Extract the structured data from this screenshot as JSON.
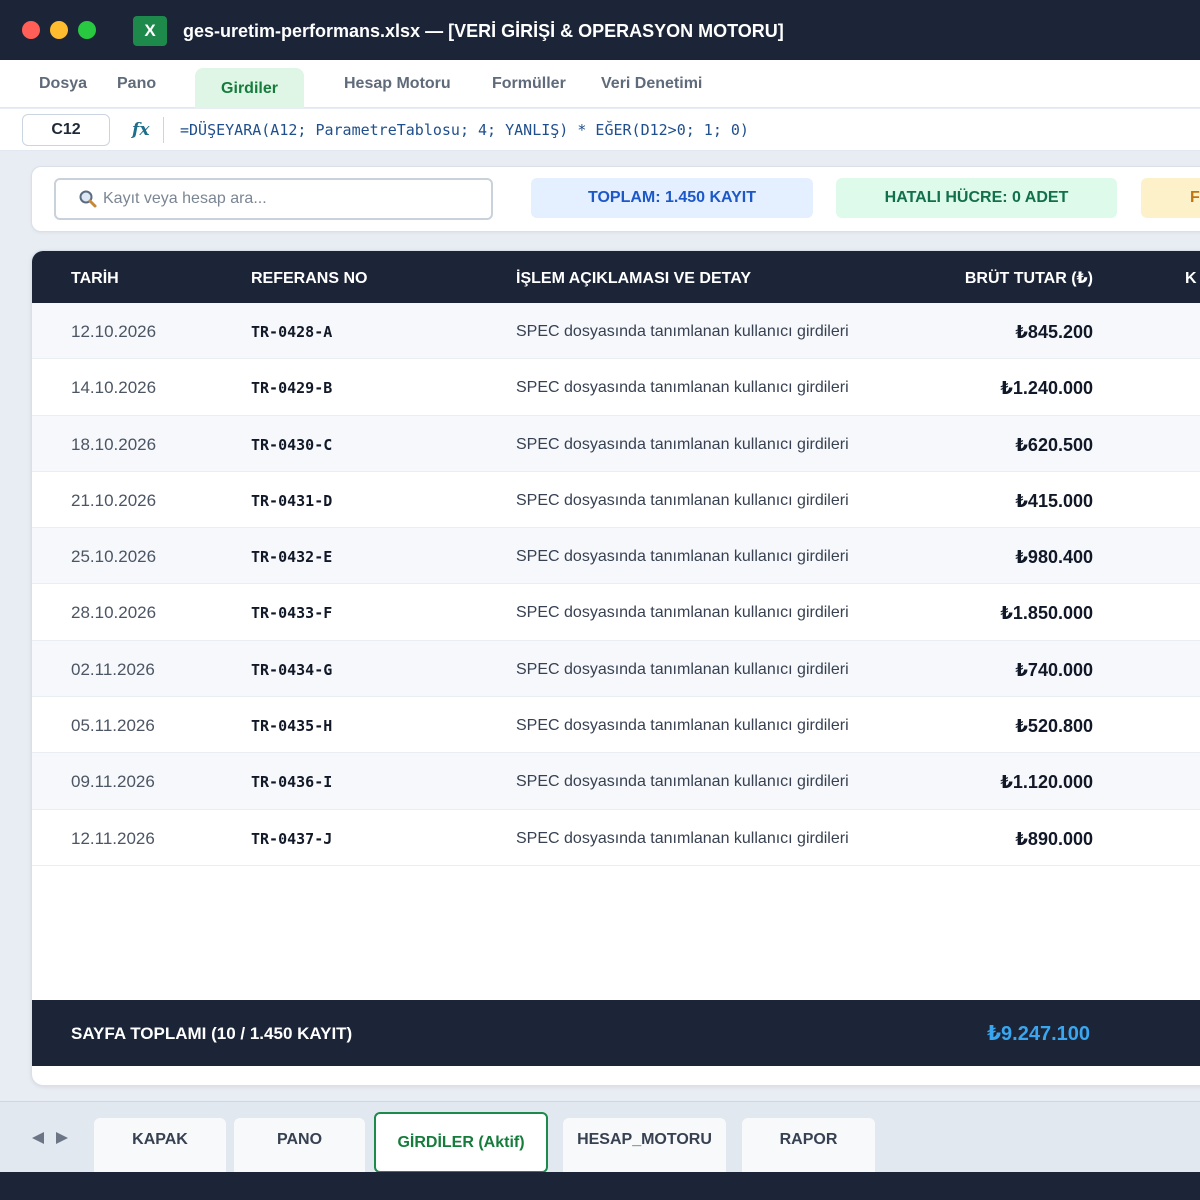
{
  "window": {
    "title": "ges-uretim-performans.xlsx — [VERİ GİRİŞİ & OPERASYON MOTORU]",
    "app_icon_glyph": "X",
    "app_icon_name": "excel-icon",
    "accent_color": "#1d8a4b"
  },
  "menu": {
    "items": [
      "Dosya",
      "Pano",
      "Girdiler",
      "Hesap Motoru",
      "Formüller",
      "Veri Denetimi"
    ],
    "active": "Girdiler"
  },
  "formula_bar": {
    "cell_ref": "C12",
    "fx_label": "fx",
    "formula": "=DÜŞEYARA(A12; ParametreTablosu; 4; YANLIŞ) * EĞER(D12>0; 1; 0)"
  },
  "toolbar": {
    "search_placeholder": "Kayıt veya hesap ara...",
    "badges": {
      "total": "TOPLAM: 1.450 KAYIT",
      "errors": "HATALI HÜCRE: 0 ADET",
      "partial": "F"
    }
  },
  "table": {
    "columns": {
      "date": "TARİH",
      "ref": "REFERANS NO",
      "desc": "İŞLEM AÇIKLAMASI VE DETAY",
      "amount": "BRÜT TUTAR (₺)",
      "extra": "K"
    },
    "rows": [
      {
        "date": "12.10.2026",
        "ref": "TR-0428-A",
        "desc": "SPEC dosyasında tanımlanan kullanıcı girdileri",
        "amount": "₺845.200"
      },
      {
        "date": "14.10.2026",
        "ref": "TR-0429-B",
        "desc": "SPEC dosyasında tanımlanan kullanıcı girdileri",
        "amount": "₺1.240.000"
      },
      {
        "date": "18.10.2026",
        "ref": "TR-0430-C",
        "desc": "SPEC dosyasında tanımlanan kullanıcı girdileri",
        "amount": "₺620.500"
      },
      {
        "date": "21.10.2026",
        "ref": "TR-0431-D",
        "desc": "SPEC dosyasında tanımlanan kullanıcı girdileri",
        "amount": "₺415.000"
      },
      {
        "date": "25.10.2026",
        "ref": "TR-0432-E",
        "desc": "SPEC dosyasında tanımlanan kullanıcı girdileri",
        "amount": "₺980.400"
      },
      {
        "date": "28.10.2026",
        "ref": "TR-0433-F",
        "desc": "SPEC dosyasında tanımlanan kullanıcı girdileri",
        "amount": "₺1.850.000"
      },
      {
        "date": "02.11.2026",
        "ref": "TR-0434-G",
        "desc": "SPEC dosyasında tanımlanan kullanıcı girdileri",
        "amount": "₺740.000"
      },
      {
        "date": "05.11.2026",
        "ref": "TR-0435-H",
        "desc": "SPEC dosyasında tanımlanan kullanıcı girdileri",
        "amount": "₺520.800"
      },
      {
        "date": "09.11.2026",
        "ref": "TR-0436-I",
        "desc": "SPEC dosyasında tanımlanan kullanıcı girdileri",
        "amount": "₺1.120.000"
      },
      {
        "date": "12.11.2026",
        "ref": "TR-0437-J",
        "desc": "SPEC dosyasında tanımlanan kullanıcı girdileri",
        "amount": "₺890.000"
      }
    ],
    "footer": {
      "label": "SAYFA TOPLAMI (10 / 1.450 KAYIT)",
      "total": "₺9.247.100"
    }
  },
  "sheet_tabs": {
    "items": [
      "KAPAK",
      "PANO",
      "GİRDİLER (Aktif)",
      "HESAP_MOTORU",
      "RAPOR"
    ],
    "active": "GİRDİLER (Aktif)"
  }
}
